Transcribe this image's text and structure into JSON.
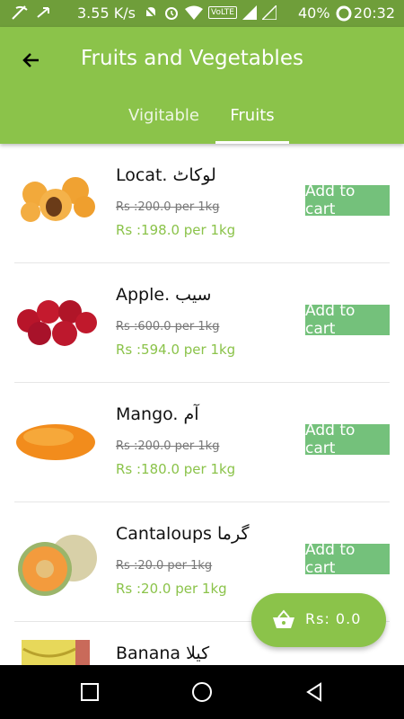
{
  "status_bar": {
    "network_speed": "3.55 K/s",
    "volte_label": "VoLTE",
    "battery_percent": "40%",
    "time": "20:32"
  },
  "app_bar": {
    "title": "Fruits and Vegetables",
    "back_icon": "arrow-left-icon",
    "color": "#8bc34a"
  },
  "tabs": [
    {
      "label": "Vigitable",
      "selected": false
    },
    {
      "label": "Fruits",
      "selected": true
    }
  ],
  "products": [
    {
      "name": "Locat. لوکاٹ",
      "old_price": "Rs :200.0 per 1kg",
      "new_price": "Rs :198.0 per 1kg",
      "button_label": "Add to cart",
      "image": "loquat-image"
    },
    {
      "name": "Apple. سیب",
      "old_price": "Rs :600.0 per 1kg",
      "new_price": "Rs :594.0 per 1kg",
      "button_label": "Add to cart",
      "image": "apple-image"
    },
    {
      "name": "Mango. آم",
      "old_price": "Rs :200.0 per 1kg",
      "new_price": "Rs :180.0 per 1kg",
      "button_label": "Add to cart",
      "image": "mango-image"
    },
    {
      "name": "Cantaloups گرما",
      "old_price": "Rs :20.0 per 1kg",
      "new_price": "Rs :20.0 per 1kg",
      "button_label": "Add to cart",
      "image": "cantaloupe-image"
    },
    {
      "name": "Banana کیلا",
      "old_price": "",
      "new_price": "",
      "button_label": "",
      "image": "banana-image"
    }
  ],
  "cart_fab": {
    "total_label": "Rs: 0.0",
    "icon": "basket-icon"
  },
  "nav_bar": {
    "icons": [
      "recents-square-icon",
      "home-circle-icon",
      "back-triangle-icon"
    ]
  }
}
